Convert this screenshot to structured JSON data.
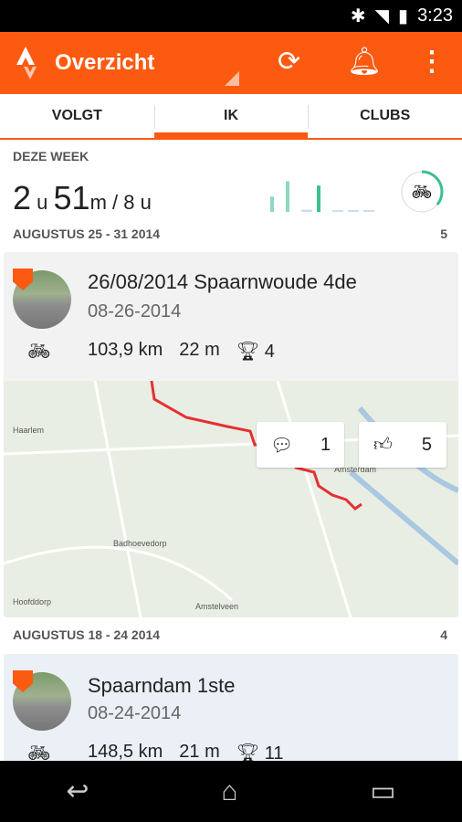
{
  "status": {
    "time": "3:23"
  },
  "appbar": {
    "title": "Overzicht",
    "icons": [
      "refresh-icon",
      "bell-icon",
      "overflow-menu-icon"
    ]
  },
  "tabs": [
    {
      "label": "VOLGT"
    },
    {
      "label": "IK",
      "active": true
    },
    {
      "label": "CLUBS"
    }
  ],
  "week": {
    "label": "DEZE WEEK",
    "hours": "2",
    "hours_unit": "u",
    "minutes": "51",
    "minutes_unit": "m / 8 u",
    "goal_progress": 0.36,
    "daily_bars": [
      0.35,
      0.7,
      0.05,
      0.6,
      0,
      0,
      0
    ],
    "accent": "#3dbf8f"
  },
  "groups": [
    {
      "range": "AUGUSTUS 25 - 31 2014",
      "count": "5",
      "activity": {
        "title": "26/08/2014 Spaarnwoude 4de",
        "date": "08-26-2014",
        "distance": "103,9 km",
        "elevation": "22 m",
        "trophies": "4",
        "comments": "1",
        "kudos": "5",
        "map_labels": [
          "Haarlem",
          "Amsterdam",
          "Hoofddorp",
          "Amstelveen",
          "Badhoevedorp"
        ]
      }
    },
    {
      "range": "AUGUSTUS 18 - 24 2014",
      "count": "4",
      "activity": {
        "title": "Spaarndam 1ste",
        "date": "08-24-2014",
        "distance": "148,5 km",
        "elevation": "21 m",
        "trophies": "11"
      }
    }
  ],
  "colors": {
    "brand": "#fc5a10",
    "route": "#e53030"
  }
}
